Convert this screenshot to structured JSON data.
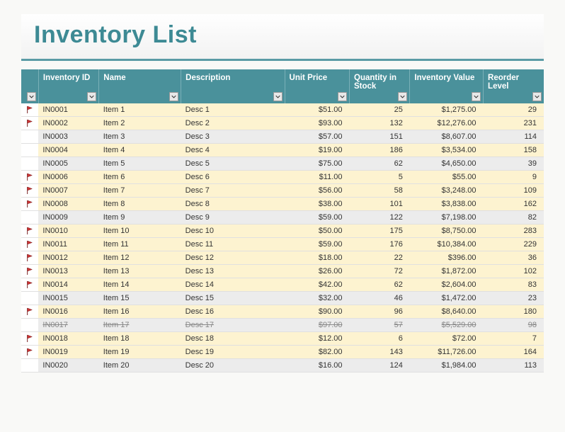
{
  "title": "Inventory List",
  "headers": {
    "flag": "",
    "id": "Inventory ID",
    "name": "Name",
    "desc": "Description",
    "price": "Unit Price",
    "qty": "Quantity in Stock",
    "value": "Inventory Value",
    "reorder": "Reorder Level"
  },
  "rows": [
    {
      "flag": true,
      "id": "IN0001",
      "name": "Item 1",
      "desc": "Desc 1",
      "price": "$51.00",
      "qty": "25",
      "value": "$1,275.00",
      "reorder": "29",
      "band": "a",
      "strike": false
    },
    {
      "flag": true,
      "id": "IN0002",
      "name": "Item 2",
      "desc": "Desc 2",
      "price": "$93.00",
      "qty": "132",
      "value": "$12,276.00",
      "reorder": "231",
      "band": "a",
      "strike": false
    },
    {
      "flag": false,
      "id": "IN0003",
      "name": "Item 3",
      "desc": "Desc 3",
      "price": "$57.00",
      "qty": "151",
      "value": "$8,607.00",
      "reorder": "114",
      "band": "b",
      "strike": false
    },
    {
      "flag": false,
      "id": "IN0004",
      "name": "Item 4",
      "desc": "Desc 4",
      "price": "$19.00",
      "qty": "186",
      "value": "$3,534.00",
      "reorder": "158",
      "band": "a",
      "strike": false
    },
    {
      "flag": false,
      "id": "IN0005",
      "name": "Item 5",
      "desc": "Desc 5",
      "price": "$75.00",
      "qty": "62",
      "value": "$4,650.00",
      "reorder": "39",
      "band": "b",
      "strike": false
    },
    {
      "flag": true,
      "id": "IN0006",
      "name": "Item 6",
      "desc": "Desc 6",
      "price": "$11.00",
      "qty": "5",
      "value": "$55.00",
      "reorder": "9",
      "band": "a",
      "strike": false
    },
    {
      "flag": true,
      "id": "IN0007",
      "name": "Item 7",
      "desc": "Desc 7",
      "price": "$56.00",
      "qty": "58",
      "value": "$3,248.00",
      "reorder": "109",
      "band": "a",
      "strike": false
    },
    {
      "flag": true,
      "id": "IN0008",
      "name": "Item 8",
      "desc": "Desc 8",
      "price": "$38.00",
      "qty": "101",
      "value": "$3,838.00",
      "reorder": "162",
      "band": "a",
      "strike": false
    },
    {
      "flag": false,
      "id": "IN0009",
      "name": "Item 9",
      "desc": "Desc 9",
      "price": "$59.00",
      "qty": "122",
      "value": "$7,198.00",
      "reorder": "82",
      "band": "b",
      "strike": false
    },
    {
      "flag": true,
      "id": "IN0010",
      "name": "Item 10",
      "desc": "Desc 10",
      "price": "$50.00",
      "qty": "175",
      "value": "$8,750.00",
      "reorder": "283",
      "band": "a",
      "strike": false
    },
    {
      "flag": true,
      "id": "IN0011",
      "name": "Item 11",
      "desc": "Desc 11",
      "price": "$59.00",
      "qty": "176",
      "value": "$10,384.00",
      "reorder": "229",
      "band": "a",
      "strike": false
    },
    {
      "flag": true,
      "id": "IN0012",
      "name": "Item 12",
      "desc": "Desc 12",
      "price": "$18.00",
      "qty": "22",
      "value": "$396.00",
      "reorder": "36",
      "band": "a",
      "strike": false
    },
    {
      "flag": true,
      "id": "IN0013",
      "name": "Item 13",
      "desc": "Desc 13",
      "price": "$26.00",
      "qty": "72",
      "value": "$1,872.00",
      "reorder": "102",
      "band": "a",
      "strike": false
    },
    {
      "flag": true,
      "id": "IN0014",
      "name": "Item 14",
      "desc": "Desc 14",
      "price": "$42.00",
      "qty": "62",
      "value": "$2,604.00",
      "reorder": "83",
      "band": "a",
      "strike": false
    },
    {
      "flag": false,
      "id": "IN0015",
      "name": "Item 15",
      "desc": "Desc 15",
      "price": "$32.00",
      "qty": "46",
      "value": "$1,472.00",
      "reorder": "23",
      "band": "b",
      "strike": false
    },
    {
      "flag": true,
      "id": "IN0016",
      "name": "Item 16",
      "desc": "Desc 16",
      "price": "$90.00",
      "qty": "96",
      "value": "$8,640.00",
      "reorder": "180",
      "band": "a",
      "strike": false
    },
    {
      "flag": false,
      "id": "IN0017",
      "name": "Item 17",
      "desc": "Desc 17",
      "price": "$97.00",
      "qty": "57",
      "value": "$5,529.00",
      "reorder": "98",
      "band": "b",
      "strike": true
    },
    {
      "flag": true,
      "id": "IN0018",
      "name": "Item 18",
      "desc": "Desc 18",
      "price": "$12.00",
      "qty": "6",
      "value": "$72.00",
      "reorder": "7",
      "band": "a",
      "strike": false
    },
    {
      "flag": true,
      "id": "IN0019",
      "name": "Item 19",
      "desc": "Desc 19",
      "price": "$82.00",
      "qty": "143",
      "value": "$11,726.00",
      "reorder": "164",
      "band": "a",
      "strike": false
    },
    {
      "flag": false,
      "id": "IN0020",
      "name": "Item 20",
      "desc": "Desc 20",
      "price": "$16.00",
      "qty": "124",
      "value": "$1,984.00",
      "reorder": "113",
      "band": "b",
      "strike": false
    }
  ]
}
